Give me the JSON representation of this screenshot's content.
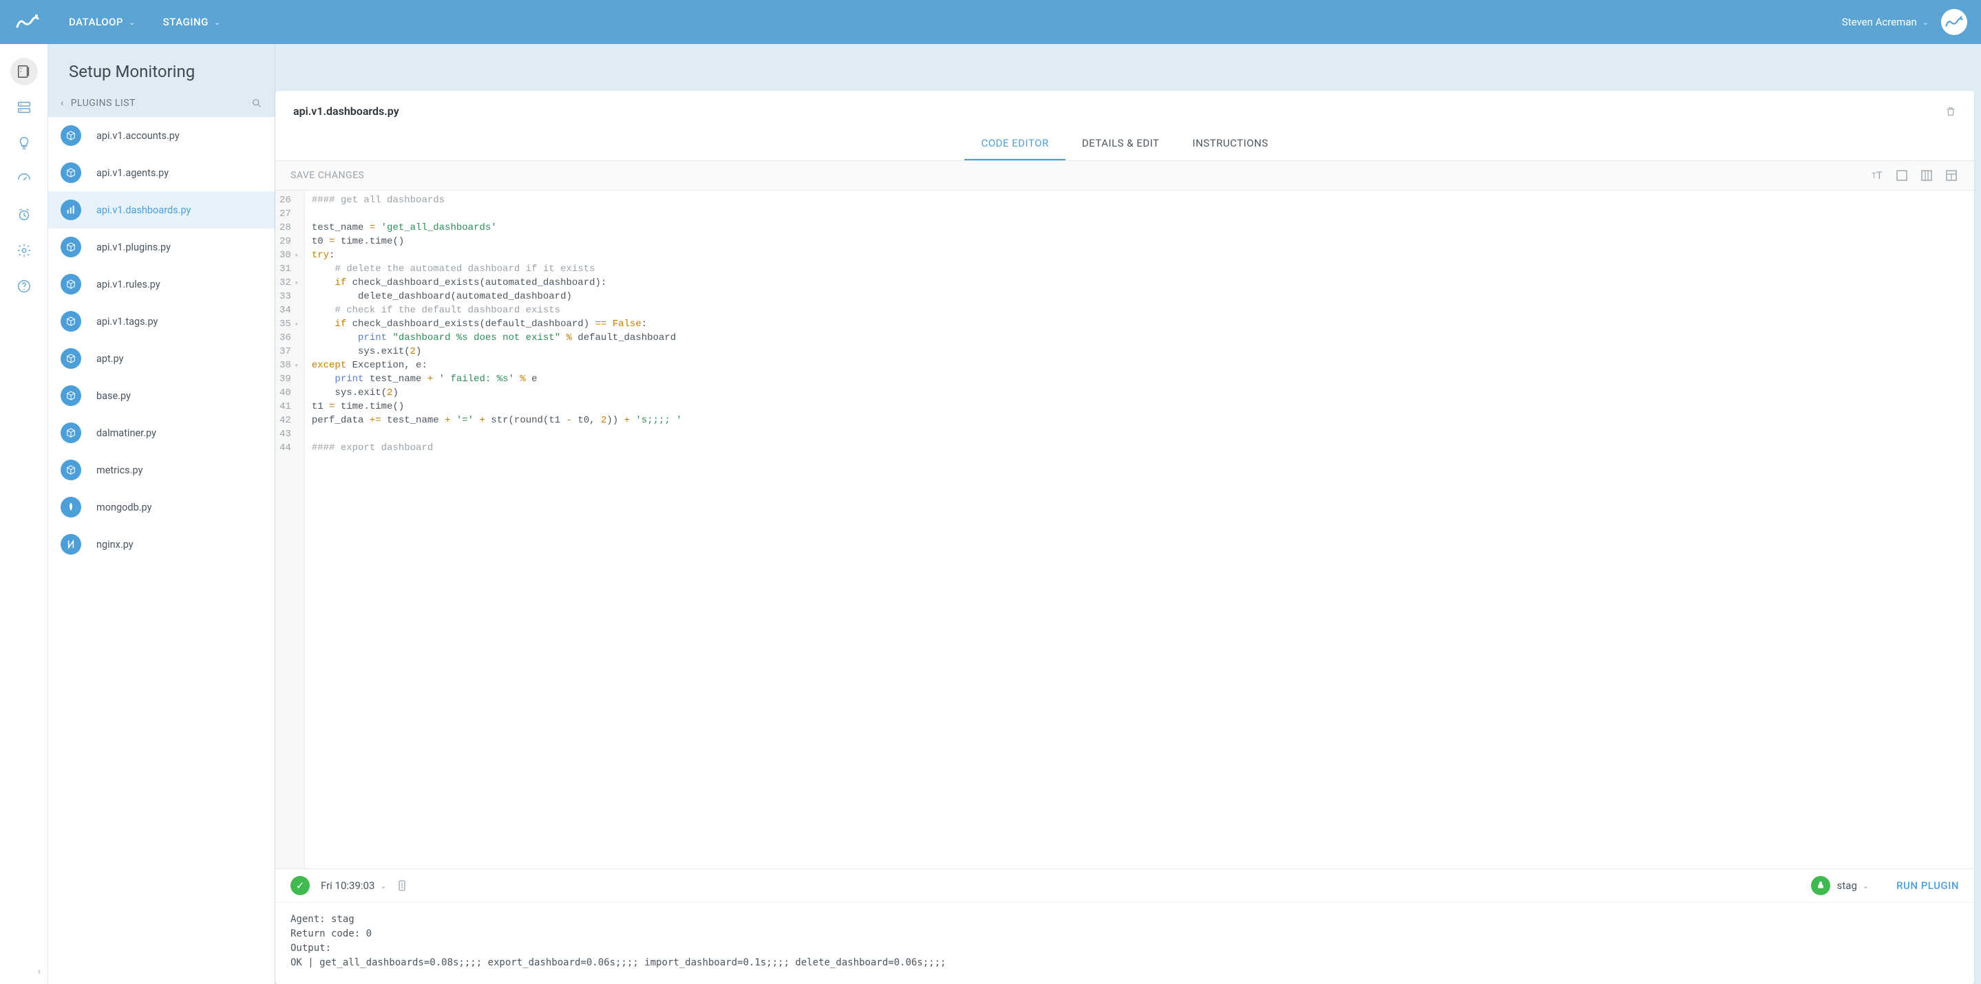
{
  "topbar": {
    "org_label": "DATALOOP",
    "env_label": "STAGING",
    "user_name": "Steven Acreman"
  },
  "iconrail": {
    "items": [
      {
        "name": "setup-icon",
        "active": true
      },
      {
        "name": "servers-icon",
        "active": false
      },
      {
        "name": "insights-icon",
        "active": false
      },
      {
        "name": "dashboard-icon",
        "active": false
      },
      {
        "name": "alerts-icon",
        "active": false
      },
      {
        "name": "settings-icon",
        "active": false
      },
      {
        "name": "help-icon",
        "active": false
      }
    ]
  },
  "plugins": {
    "heading": "Setup Monitoring",
    "list_label": "PLUGINS LIST",
    "items": [
      {
        "label": "api.v1.accounts.py",
        "icon": "box",
        "selected": false
      },
      {
        "label": "api.v1.agents.py",
        "icon": "box",
        "selected": false
      },
      {
        "label": "api.v1.dashboards.py",
        "icon": "bars",
        "selected": true
      },
      {
        "label": "api.v1.plugins.py",
        "icon": "box",
        "selected": false
      },
      {
        "label": "api.v1.rules.py",
        "icon": "box",
        "selected": false
      },
      {
        "label": "api.v1.tags.py",
        "icon": "box",
        "selected": false
      },
      {
        "label": "apt.py",
        "icon": "box",
        "selected": false
      },
      {
        "label": "base.py",
        "icon": "box",
        "selected": false
      },
      {
        "label": "dalmatiner.py",
        "icon": "box",
        "selected": false
      },
      {
        "label": "metrics.py",
        "icon": "box",
        "selected": false
      },
      {
        "label": "mongodb.py",
        "icon": "mongo",
        "selected": false
      },
      {
        "label": "nginx.py",
        "icon": "nginx",
        "selected": false
      }
    ]
  },
  "editor": {
    "file_title": "api.v1.dashboards.py",
    "tabs": [
      {
        "label": "CODE EDITOR",
        "active": true
      },
      {
        "label": "DETAILS & EDIT",
        "active": false
      },
      {
        "label": "INSTRUCTIONS",
        "active": false
      }
    ],
    "save_label": "SAVE CHANGES",
    "gutter": [
      {
        "n": 26,
        "fold": false
      },
      {
        "n": 27,
        "fold": false
      },
      {
        "n": 28,
        "fold": false
      },
      {
        "n": 29,
        "fold": false
      },
      {
        "n": 30,
        "fold": true
      },
      {
        "n": 31,
        "fold": false
      },
      {
        "n": 32,
        "fold": true
      },
      {
        "n": 33,
        "fold": false
      },
      {
        "n": 34,
        "fold": false
      },
      {
        "n": 35,
        "fold": true
      },
      {
        "n": 36,
        "fold": false
      },
      {
        "n": 37,
        "fold": false
      },
      {
        "n": 38,
        "fold": true
      },
      {
        "n": 39,
        "fold": false
      },
      {
        "n": 40,
        "fold": false
      },
      {
        "n": 41,
        "fold": false
      },
      {
        "n": 42,
        "fold": false
      },
      {
        "n": 43,
        "fold": false
      },
      {
        "n": 44,
        "fold": false
      }
    ],
    "code_lines": [
      [
        {
          "t": "#### get all dashboards",
          "c": "c-comment"
        }
      ],
      [],
      [
        {
          "t": "test_name ",
          "c": ""
        },
        {
          "t": "=",
          "c": "c-op"
        },
        {
          "t": " ",
          "c": ""
        },
        {
          "t": "'get_all_dashboards'",
          "c": "c-string"
        }
      ],
      [
        {
          "t": "t0 ",
          "c": ""
        },
        {
          "t": "=",
          "c": "c-op"
        },
        {
          "t": " time.time()",
          "c": ""
        }
      ],
      [
        {
          "t": "try",
          "c": "c-keyword"
        },
        {
          "t": ":",
          "c": ""
        }
      ],
      [
        {
          "t": "    ",
          "c": ""
        },
        {
          "t": "# delete the automated dashboard if it exists",
          "c": "c-comment"
        }
      ],
      [
        {
          "t": "    ",
          "c": ""
        },
        {
          "t": "if",
          "c": "c-keyword"
        },
        {
          "t": " check_dashboard_exists(automated_dashboard):",
          "c": ""
        }
      ],
      [
        {
          "t": "        delete_dashboard(automated_dashboard)",
          "c": ""
        }
      ],
      [
        {
          "t": "    ",
          "c": ""
        },
        {
          "t": "# check if the default dashboard exists",
          "c": "c-comment"
        }
      ],
      [
        {
          "t": "    ",
          "c": ""
        },
        {
          "t": "if",
          "c": "c-keyword"
        },
        {
          "t": " check_dashboard_exists(default_dashboard) ",
          "c": ""
        },
        {
          "t": "==",
          "c": "c-op"
        },
        {
          "t": " ",
          "c": ""
        },
        {
          "t": "False",
          "c": "c-const"
        },
        {
          "t": ":",
          "c": ""
        }
      ],
      [
        {
          "t": "        ",
          "c": ""
        },
        {
          "t": "print",
          "c": "c-builtin"
        },
        {
          "t": " ",
          "c": ""
        },
        {
          "t": "\"dashboard %s does not exist\"",
          "c": "c-string"
        },
        {
          "t": " ",
          "c": ""
        },
        {
          "t": "%",
          "c": "c-op"
        },
        {
          "t": " default_dashboard",
          "c": ""
        }
      ],
      [
        {
          "t": "        sys.exit(",
          "c": ""
        },
        {
          "t": "2",
          "c": "c-num"
        },
        {
          "t": ")",
          "c": ""
        }
      ],
      [
        {
          "t": "except",
          "c": "c-keyword"
        },
        {
          "t": " Exception, e:",
          "c": ""
        }
      ],
      [
        {
          "t": "    ",
          "c": ""
        },
        {
          "t": "print",
          "c": "c-builtin"
        },
        {
          "t": " test_name ",
          "c": ""
        },
        {
          "t": "+",
          "c": "c-op"
        },
        {
          "t": " ",
          "c": ""
        },
        {
          "t": "' failed: %s'",
          "c": "c-string"
        },
        {
          "t": " ",
          "c": ""
        },
        {
          "t": "%",
          "c": "c-op"
        },
        {
          "t": " e",
          "c": ""
        }
      ],
      [
        {
          "t": "    sys.exit(",
          "c": ""
        },
        {
          "t": "2",
          "c": "c-num"
        },
        {
          "t": ")",
          "c": ""
        }
      ],
      [
        {
          "t": "t1 ",
          "c": ""
        },
        {
          "t": "=",
          "c": "c-op"
        },
        {
          "t": " time.time()",
          "c": ""
        }
      ],
      [
        {
          "t": "perf_data ",
          "c": ""
        },
        {
          "t": "+=",
          "c": "c-op"
        },
        {
          "t": " test_name ",
          "c": ""
        },
        {
          "t": "+",
          "c": "c-op"
        },
        {
          "t": " ",
          "c": ""
        },
        {
          "t": "'='",
          "c": "c-string"
        },
        {
          "t": " ",
          "c": ""
        },
        {
          "t": "+",
          "c": "c-op"
        },
        {
          "t": " str(round(t1 ",
          "c": ""
        },
        {
          "t": "-",
          "c": "c-op"
        },
        {
          "t": " t0, ",
          "c": ""
        },
        {
          "t": "2",
          "c": "c-num"
        },
        {
          "t": ")) ",
          "c": ""
        },
        {
          "t": "+",
          "c": "c-op"
        },
        {
          "t": " ",
          "c": ""
        },
        {
          "t": "'s;;;; '",
          "c": "c-string"
        }
      ],
      [],
      [
        {
          "t": "#### export dashboard",
          "c": "c-comment"
        }
      ]
    ]
  },
  "run": {
    "timestamp": "Fri 10:39:03",
    "agent_name": "stag",
    "run_button": "RUN PLUGIN",
    "output": "Agent: stag\nReturn code: 0\nOutput:\nOK | get_all_dashboards=0.08s;;;; export_dashboard=0.06s;;;; import_dashboard=0.1s;;;; delete_dashboard=0.06s;;;;"
  }
}
